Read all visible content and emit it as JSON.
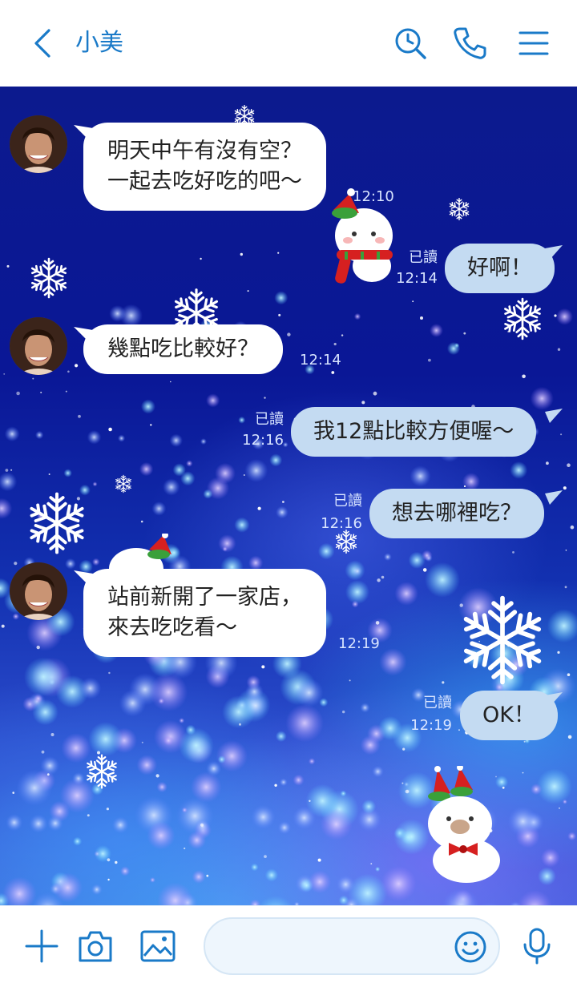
{
  "header": {
    "contact_name": "小美",
    "icons": [
      "back-icon",
      "search-history-icon",
      "phone-icon",
      "menu-icon"
    ]
  },
  "messages": [
    {
      "side": "left",
      "lines": [
        "明天中午有沒有空？",
        "一起去吃好吃的吧～"
      ],
      "time": "12:10"
    },
    {
      "side": "right",
      "text": "好啊！",
      "read": "已讀",
      "time": "12:14"
    },
    {
      "side": "left",
      "lines": [
        "幾點吃比較好？"
      ],
      "time": "12:14"
    },
    {
      "side": "right",
      "text": "我12點比較方便喔～",
      "read": "已讀",
      "time": "12:16"
    },
    {
      "side": "right",
      "text": "想去哪裡吃？",
      "read": "已讀",
      "time": "12:16"
    },
    {
      "side": "left",
      "lines": [
        "站前新開了一家店，",
        "來去吃吃看～"
      ],
      "time": "12:19"
    },
    {
      "side": "right",
      "text": "OK！",
      "read": "已讀",
      "time": "12:19"
    }
  ],
  "input": {
    "value": "",
    "placeholder": "",
    "icons": [
      "plus-icon",
      "camera-icon",
      "image-icon",
      "emoji-icon",
      "mic-icon"
    ]
  },
  "colors": {
    "accent": "#1a7ac8",
    "sent_bubble": "#c4dbf2",
    "received_bubble": "#ffffff",
    "chat_background": "#0a1796"
  }
}
